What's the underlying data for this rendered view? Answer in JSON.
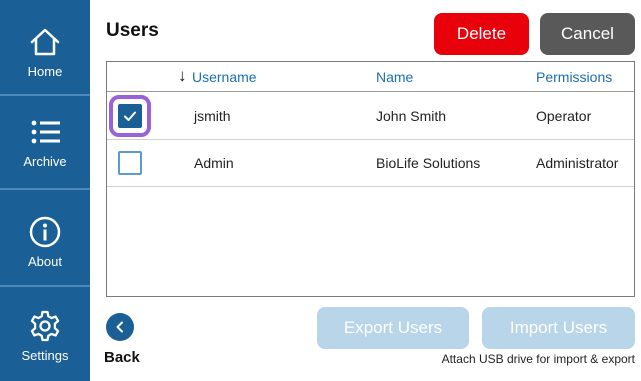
{
  "sidebar": {
    "items": [
      {
        "label": "Home",
        "icon": "home-icon"
      },
      {
        "label": "Archive",
        "icon": "list-icon"
      },
      {
        "label": "About",
        "icon": "info-icon"
      },
      {
        "label": "Settings",
        "icon": "gear-icon"
      }
    ],
    "background": "#1a5f96"
  },
  "header": {
    "title": "Users",
    "delete_label": "Delete",
    "cancel_label": "Cancel"
  },
  "table": {
    "columns": [
      "Username",
      "Name",
      "Permissions"
    ],
    "sort_indicator": "↓",
    "rows": [
      {
        "selected": true,
        "username": "jsmith",
        "name": "John Smith",
        "permissions": "Operator"
      },
      {
        "selected": false,
        "username": "Admin",
        "name": "BioLife Solutions",
        "permissions": "Administrator"
      }
    ]
  },
  "footer": {
    "back_label": "Back",
    "export_label": "Export Users",
    "import_label": "Import Users",
    "usb_note": "Attach USB drive for import & export"
  },
  "colors": {
    "accent": "#1a5f96",
    "danger": "#e8000b",
    "neutral": "#595959",
    "disabled": "#b8d5ea",
    "highlight": "#9a62d6",
    "header_text": "#1a6fb5"
  }
}
